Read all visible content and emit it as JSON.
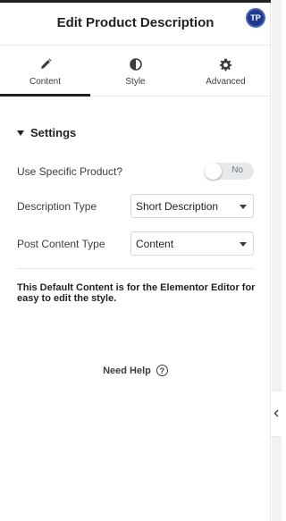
{
  "header": {
    "title": "Edit Product Description",
    "badge": "TP"
  },
  "tabs": [
    {
      "label": "Content",
      "icon": "pencil-icon",
      "active": true
    },
    {
      "label": "Style",
      "icon": "contrast-icon",
      "active": false
    },
    {
      "label": "Advanced",
      "icon": "gear-icon",
      "active": false
    }
  ],
  "section": {
    "title": "Settings",
    "expanded": true
  },
  "fields": {
    "use_specific_product": {
      "label": "Use Specific Product?",
      "toggle_text": "No",
      "value": false
    },
    "description_type": {
      "label": "Description Type",
      "value": "Short Description"
    },
    "post_content_type": {
      "label": "Post Content Type",
      "value": "Content"
    }
  },
  "note": "This Default Content is for the Elementor Editor for easy to edit the style.",
  "help": {
    "label": "Need Help",
    "icon": "question-circle-icon"
  },
  "colors": {
    "accent": "#1f2124",
    "badge": "#1f3a8a",
    "border": "#e6e8ea"
  }
}
